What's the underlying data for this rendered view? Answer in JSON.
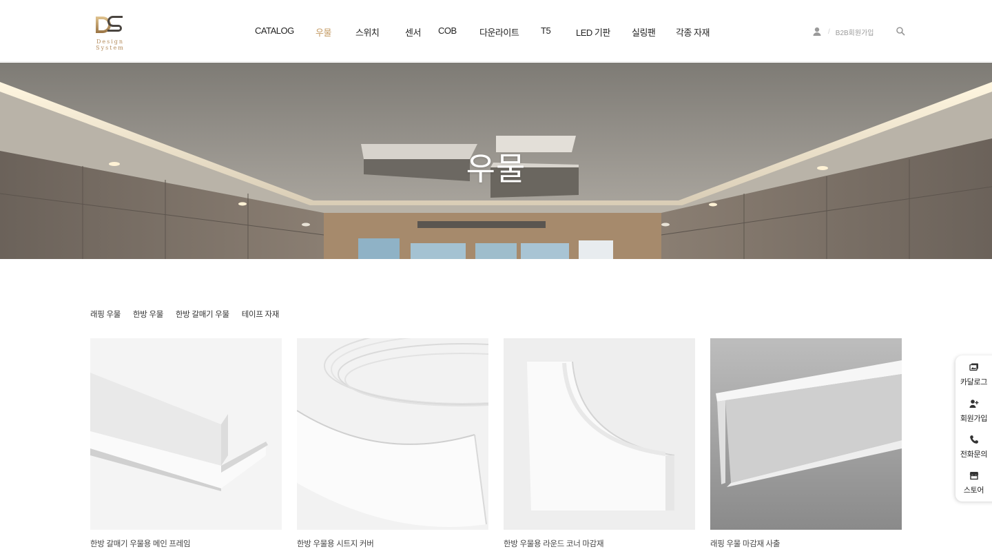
{
  "brand": {
    "logo_mark": "DS",
    "logo_text": "Design System"
  },
  "nav": {
    "items": [
      {
        "label": "CATALOG",
        "active": false
      },
      {
        "label": "우물",
        "active": true
      },
      {
        "label": "스위치",
        "active": false
      },
      {
        "label": "센서",
        "active": false
      },
      {
        "label": "COB",
        "active": false
      },
      {
        "label": "다운라이트",
        "active": false
      },
      {
        "label": "T5",
        "active": false
      },
      {
        "label": "LED 기판",
        "active": false
      },
      {
        "label": "실링팬",
        "active": false
      },
      {
        "label": "각종 자재",
        "active": false
      }
    ]
  },
  "header_right": {
    "user_icon": "user-icon",
    "separator": "/",
    "b2b_label": "B2B회원가입",
    "search_icon": "search-icon"
  },
  "hero": {
    "title": "우물"
  },
  "subtabs": [
    "래핑 우물",
    "한방 우물",
    "한방 갈매기 우물",
    "테이프 자재"
  ],
  "products": [
    {
      "name": "한방 갈매기 우물용 메인 프레임"
    },
    {
      "name": "한방 우물용 시트지 커버"
    },
    {
      "name": "한방 우물용 라운드 코너 마감재"
    },
    {
      "name": "래핑 우물 마감재 사출"
    }
  ],
  "quick_menu": [
    {
      "label": "카달로그",
      "icon": "catalog-images-icon"
    },
    {
      "label": "회원가입",
      "icon": "user-plus-icon"
    },
    {
      "label": "전화문의",
      "icon": "phone-icon"
    },
    {
      "label": "스토어",
      "icon": "store-icon"
    }
  ],
  "colors": {
    "accent": "#c49a63",
    "text": "#222222"
  }
}
